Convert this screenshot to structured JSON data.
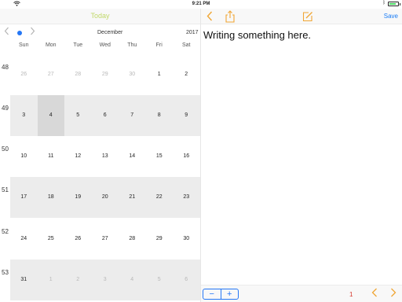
{
  "status_bar": {
    "time": "9:21 PM",
    "wifi_icon": "wifi-icon",
    "bluetooth_icon": "bluetooth-icon",
    "battery_icon": "battery-icon",
    "battery_level": 0.7
  },
  "nav": {
    "today_label": "Today",
    "back_icon": "chevron-left-icon",
    "share_icon": "share-icon",
    "edit_icon": "compose-icon",
    "save_label": "Save"
  },
  "calendar": {
    "month": "December",
    "year": "2017",
    "weekdays": [
      "Sun",
      "Mon",
      "Tue",
      "Wed",
      "Thu",
      "Fri",
      "Sat"
    ],
    "weeks": [
      {
        "num": "48",
        "days": [
          "26",
          "27",
          "28",
          "29",
          "30",
          "1",
          "2"
        ]
      },
      {
        "num": "49",
        "days": [
          "3",
          "4",
          "5",
          "6",
          "7",
          "8",
          "9"
        ]
      },
      {
        "num": "50",
        "days": [
          "10",
          "11",
          "12",
          "13",
          "14",
          "15",
          "16"
        ]
      },
      {
        "num": "51",
        "days": [
          "17",
          "18",
          "19",
          "20",
          "21",
          "22",
          "23"
        ]
      },
      {
        "num": "52",
        "days": [
          "24",
          "25",
          "26",
          "27",
          "28",
          "29",
          "30"
        ]
      },
      {
        "num": "53",
        "days": [
          "31",
          "1",
          "2",
          "3",
          "4",
          "5",
          "6"
        ]
      }
    ]
  },
  "note": {
    "text": "Writing something here."
  },
  "toolbar": {
    "minus_label": "−",
    "plus_label": "+",
    "page": "1"
  },
  "colors": {
    "accent_orange": "#f0a634",
    "today_green": "#c1d96a",
    "link_blue": "#1a7cf5",
    "page_red": "#d6372b"
  }
}
